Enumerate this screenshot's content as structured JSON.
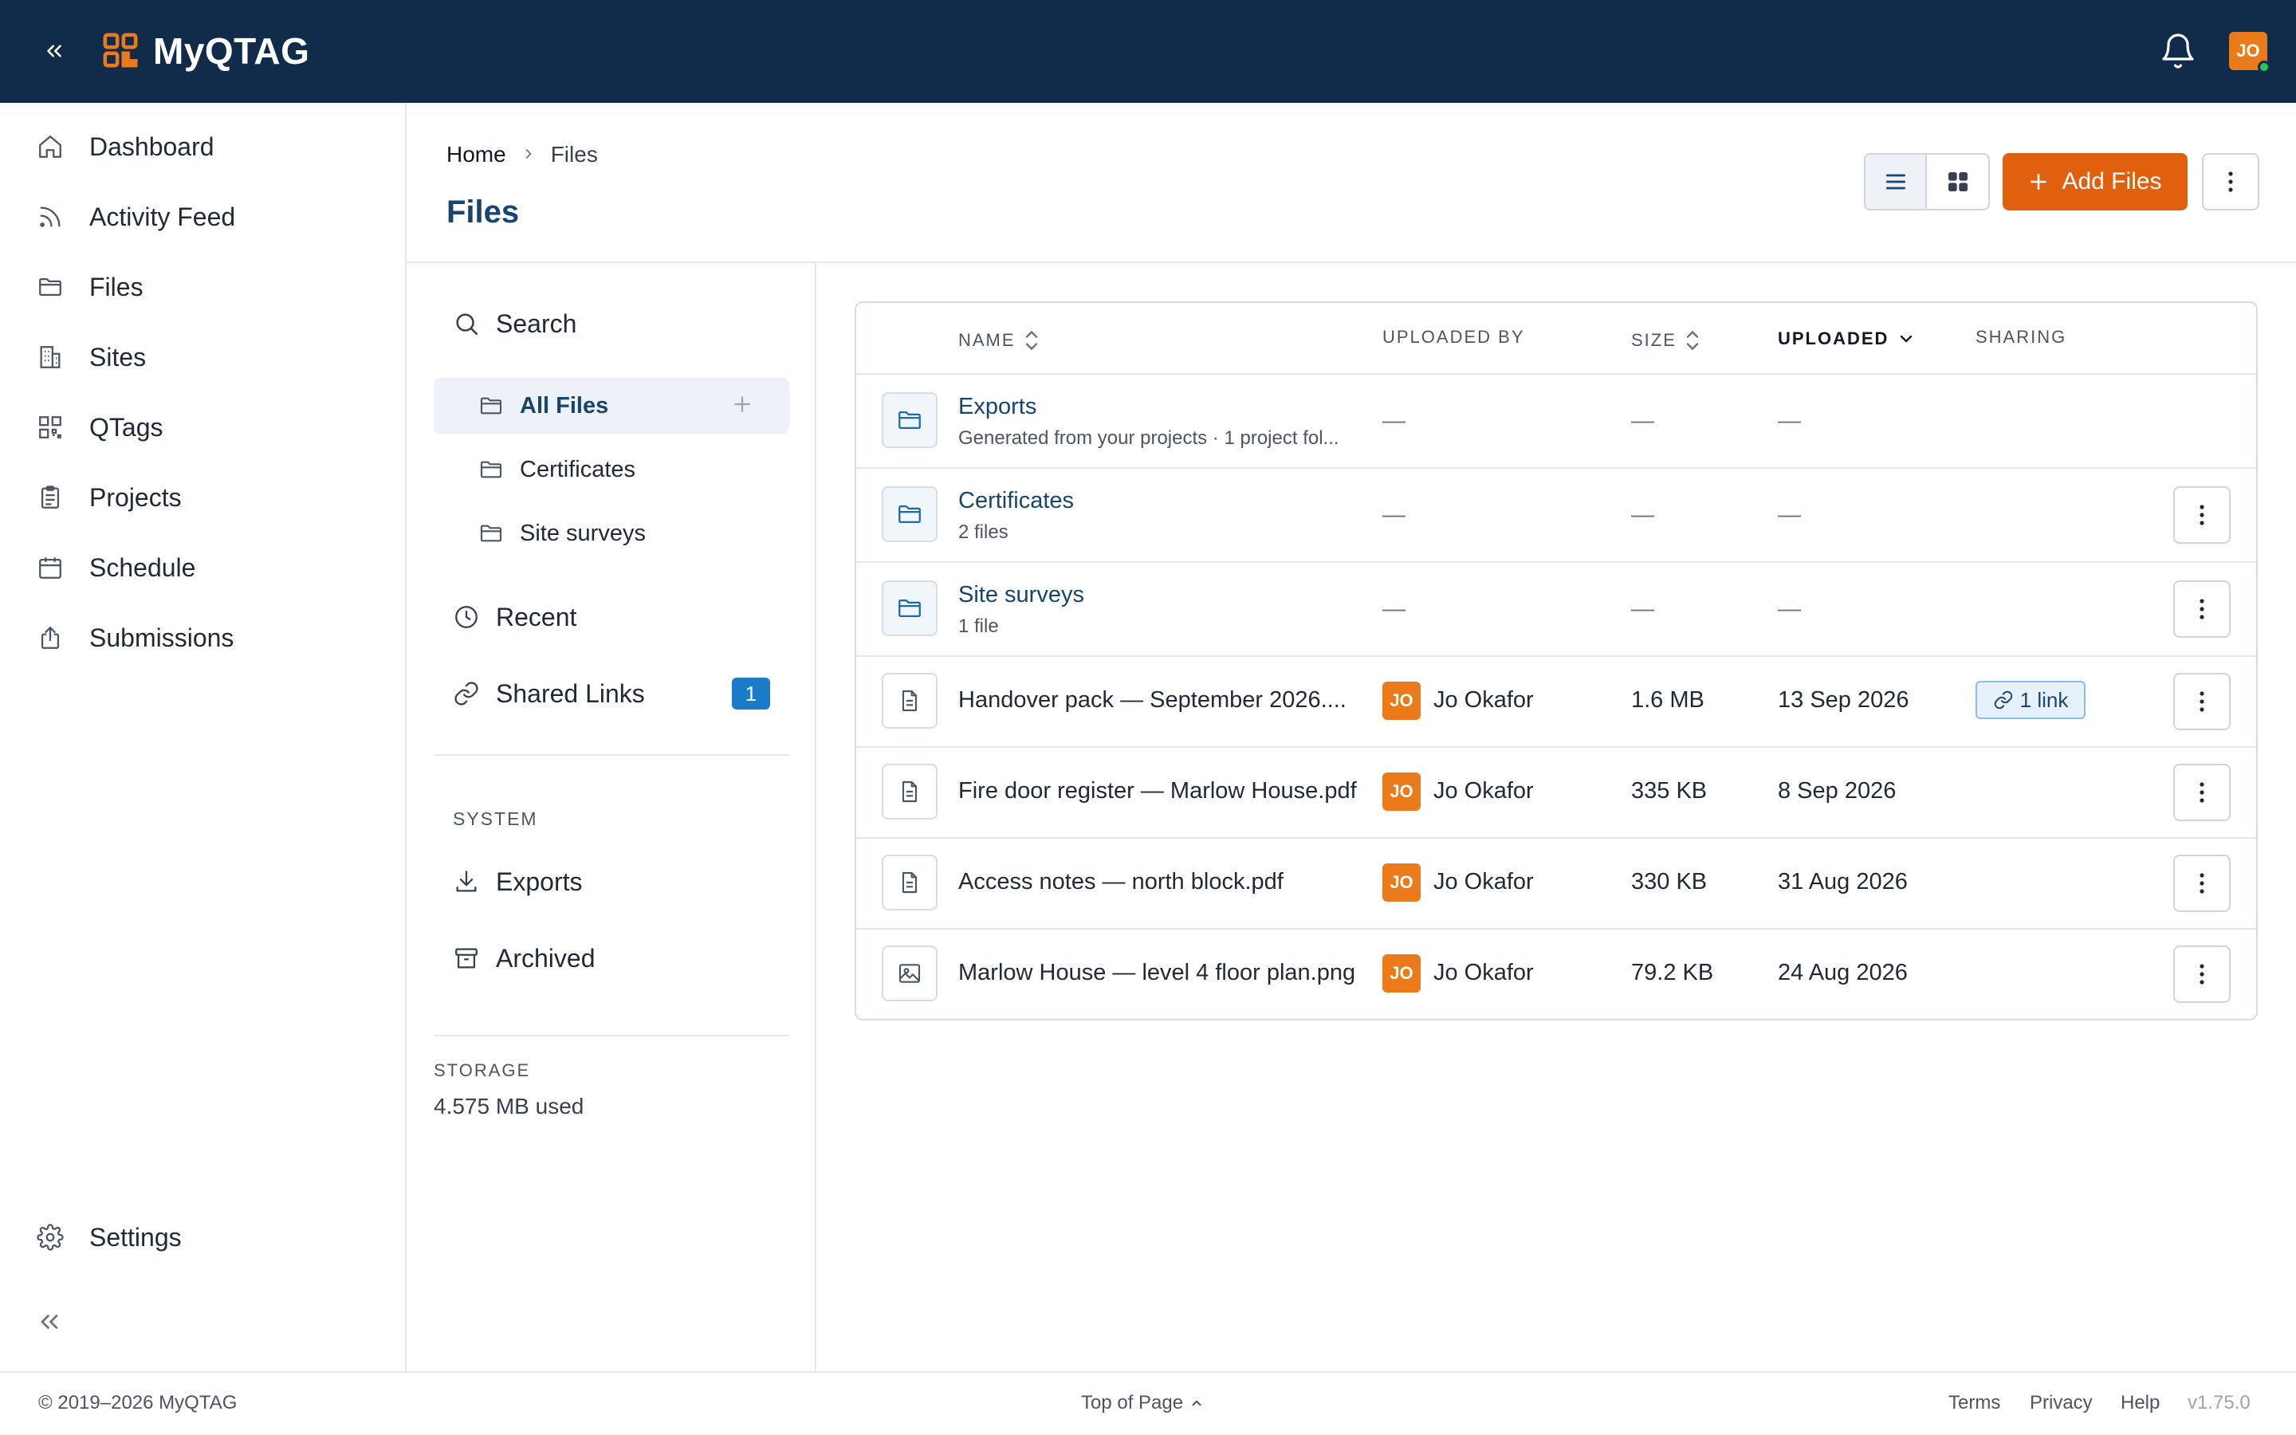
{
  "app": {
    "title": "MyQTAG",
    "user_initials": "JO"
  },
  "nav": {
    "items": [
      {
        "label": "Dashboard",
        "icon": "home-icon"
      },
      {
        "label": "Activity Feed",
        "icon": "rss-icon"
      },
      {
        "label": "Files",
        "icon": "folder-icon"
      },
      {
        "label": "Sites",
        "icon": "building-icon"
      },
      {
        "label": "QTags",
        "icon": "qr-icon"
      },
      {
        "label": "Projects",
        "icon": "clipboard-icon"
      },
      {
        "label": "Schedule",
        "icon": "calendar-icon"
      },
      {
        "label": "Submissions",
        "icon": "upload-icon"
      }
    ],
    "settings_label": "Settings"
  },
  "header": {
    "breadcrumb": [
      "Home",
      "Files"
    ],
    "title": "Files",
    "add_files_label": "Add Files"
  },
  "files_nav": {
    "search_label": "Search",
    "folders": [
      {
        "label": "All Files",
        "active": true
      },
      {
        "label": "Certificates",
        "active": false
      },
      {
        "label": "Site surveys",
        "active": false
      }
    ],
    "recent_label": "Recent",
    "shared_links_label": "Shared Links",
    "shared_links_count": "1",
    "system_heading": "SYSTEM",
    "exports_label": "Exports",
    "archived_label": "Archived",
    "storage_heading": "STORAGE",
    "storage_value": "4.575 MB used"
  },
  "table": {
    "columns": {
      "name": "NAME",
      "uploaded_by": "UPLOADED BY",
      "size": "SIZE",
      "uploaded": "UPLOADED",
      "sharing": "SHARING"
    },
    "folders": [
      {
        "name": "Exports",
        "detail": "Generated from your projects · 1 project fol...",
        "uploaded_by": "—",
        "size": "—",
        "uploaded": "—"
      },
      {
        "name": "Certificates",
        "detail": "2 files",
        "uploaded_by": "—",
        "size": "—",
        "uploaded": "—"
      },
      {
        "name": "Site surveys",
        "detail": "1 file",
        "uploaded_by": "—",
        "size": "—",
        "uploaded": "—"
      }
    ],
    "files": [
      {
        "name": "Handover pack — September 2026....",
        "type": "document",
        "initials": "JO",
        "uploader": "Jo Okafor",
        "size": "1.6 MB",
        "uploaded": "13 Sep 2026",
        "sharing": "1 link"
      },
      {
        "name": "Fire door register — Marlow House.pdf",
        "type": "document",
        "initials": "JO",
        "uploader": "Jo Okafor",
        "size": "335 KB",
        "uploaded": "8 Sep 2026",
        "sharing": ""
      },
      {
        "name": "Access notes — north block.pdf",
        "type": "document",
        "initials": "JO",
        "uploader": "Jo Okafor",
        "size": "330 KB",
        "uploaded": "31 Aug 2026",
        "sharing": ""
      },
      {
        "name": "Marlow House — level 4 floor plan.png",
        "type": "image",
        "initials": "JO",
        "uploader": "Jo Okafor",
        "size": "79.2 KB",
        "uploaded": "24 Aug 2026",
        "sharing": ""
      }
    ]
  },
  "footer": {
    "copyright": "© 2019–2026 MyQTAG",
    "top_of_page": "Top of Page",
    "links": [
      "Terms",
      "Privacy",
      "Help"
    ],
    "version": "v1.75.0"
  },
  "colors": {
    "topbar": "#112c4a",
    "accent": "#e0600e",
    "link": "#17456f",
    "badge": "#1c7bc8"
  }
}
